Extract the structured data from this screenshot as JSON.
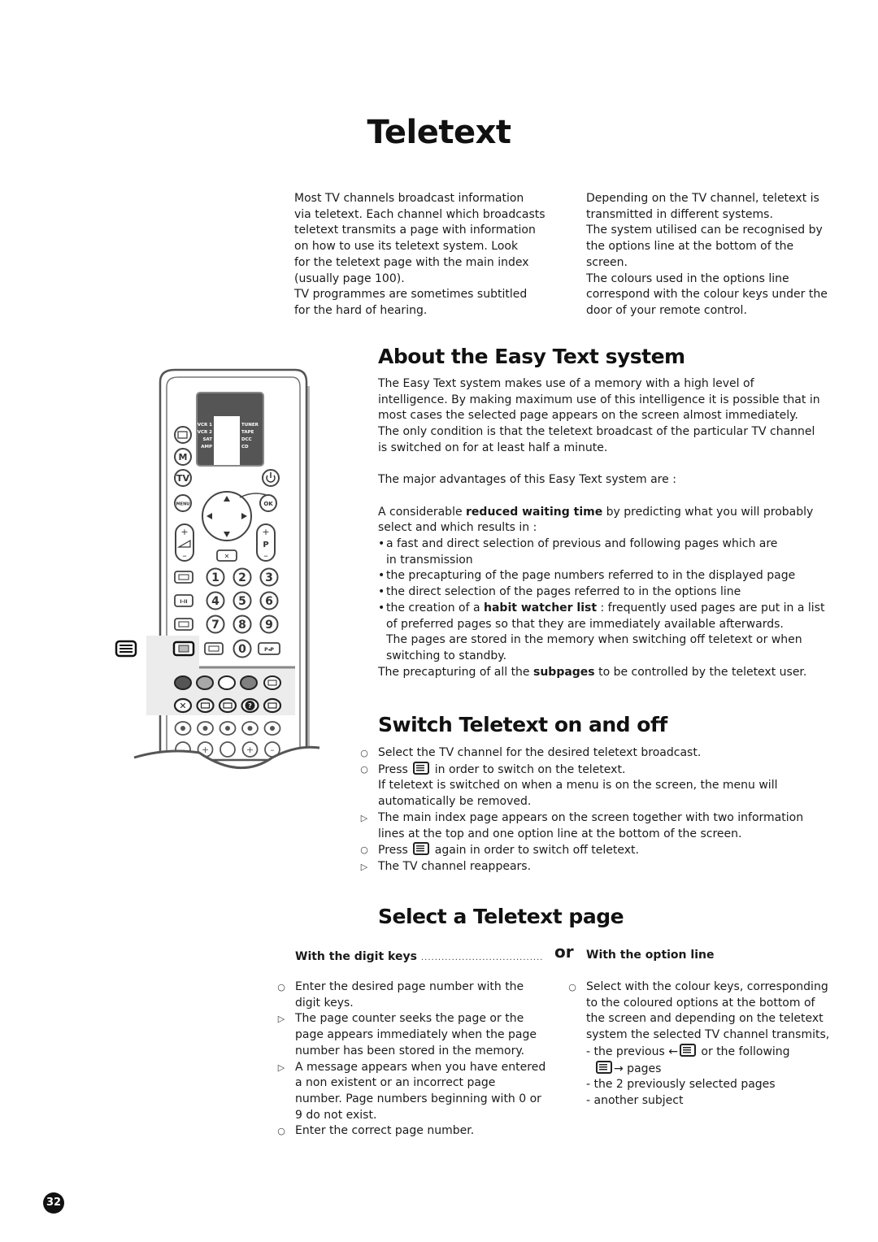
{
  "page": {
    "title": "Teletext",
    "page_number": "32"
  },
  "intro": {
    "left": [
      "Most TV channels broadcast information",
      "via teletext. Each channel which broadcasts",
      "teletext transmits a page with information",
      "on how to use its teletext system. Look",
      "for the teletext page with the main index",
      "(usually page 100).",
      "TV programmes are sometimes subtitled",
      "for the hard of hearing."
    ],
    "right": [
      "Depending on the TV channel, teletext is",
      "transmitted in different systems.",
      "The system utilised can be recognised by",
      "the options line at the bottom of the",
      "screen.",
      "The colours used in the options line",
      "correspond with the colour keys under the",
      "door of your remote control."
    ]
  },
  "easy_text": {
    "heading": "About the Easy Text system",
    "para1": [
      "The Easy Text system makes use of a memory with a high level of",
      "intelligence. By making maximum use of this intelligence it is possible that in",
      "most cases the selected page appears on the screen almost immediately.",
      "The only condition is that the teletext broadcast of the particular TV channel",
      "is switched on for at least half a minute."
    ],
    "advantages_intro": "The major advantages of this Easy Text system are :",
    "waiting_pre": "A considerable ",
    "waiting_bold": "reduced waiting time",
    "waiting_post": " by predicting what you will probably",
    "waiting_line2": "select and which results in :",
    "bullet_char": "•",
    "bullet1_line1": "a fast and direct selection of previous and following pages which are",
    "bullet1_line2": "in transmission",
    "bullet2": "the precapturing of the page numbers referred to in the displayed page",
    "bullet3": "the direct selection of the pages referred to in the options line",
    "bullet4_pre": "the creation of a ",
    "bullet4_bold": "habit watcher list",
    "bullet4_post": " : frequently used pages are put in a list",
    "bullet4_line2": "of preferred pages so that they are immediately available afterwards.",
    "bullet4_line3": "The pages are stored in the memory when switching off teletext or when",
    "bullet4_line4": "switching to standby.",
    "subpages_pre": "The precapturing of all the ",
    "subpages_bold": "subpages",
    "subpages_post": " to be controlled by the teletext user."
  },
  "switch": {
    "heading": "Switch Teletext on and off",
    "step_marker": "○",
    "result_marker": "▷",
    "s1": "Select the TV channel for the desired teletext broadcast.",
    "s2_pre": "Press ",
    "s2_post": " in order to switch on the teletext.",
    "s2_line2": "If teletext is switched on when a menu is on the screen, the menu will",
    "s2_line3": "automatically be removed.",
    "r1_line1": "The main index page appears on the screen together with two information",
    "r1_line2": "lines at the top and one option line at the bottom of the screen.",
    "s3_pre": "Press ",
    "s3_post": " again in order to switch off teletext.",
    "r2": "The TV channel reappears."
  },
  "select": {
    "heading": "Select a Teletext page",
    "digit_heading": "With the digit keys",
    "leader_dots": "....................................",
    "or": "or",
    "option_heading": "With the option line",
    "digit_steps": [
      {
        "marker": "○",
        "lines": [
          "Enter the desired page number with the",
          "digit keys."
        ]
      },
      {
        "marker": "▷",
        "lines": [
          "The page counter seeks the page or the",
          "page appears immediately when the page",
          "number has been stored in the memory."
        ]
      },
      {
        "marker": "▷",
        "lines": [
          "A message appears when you have entered",
          "a non existent or an incorrect page",
          "number. Page numbers beginning with 0 or",
          "9 do not exist."
        ]
      },
      {
        "marker": "○",
        "lines": [
          "Enter the correct page number."
        ]
      }
    ],
    "option_marker": "○",
    "option_lines": [
      "Select with the colour keys, corresponding",
      "to the coloured options at the bottom of",
      "the screen and depending on the teletext",
      "system the selected TV channel transmits,"
    ],
    "prev_pre": "- the previous ",
    "arrow_left": "←",
    "prev_post": " or the following",
    "arrow_right": "→",
    "next_post": " pages",
    "dash2": "- the 2 previously selected pages",
    "dash3": "- another subject"
  },
  "remote": {
    "screen_selected": "TV",
    "screen_left": [
      "VCR 1",
      "VCR 2",
      "SAT",
      "AMP"
    ],
    "screen_right": [
      "TUNER",
      "TAPE",
      "DCC",
      "CD"
    ],
    "menu_label": "MENU",
    "ok_label": "OK",
    "m_label": "M",
    "tv_label": "TV",
    "p_label": "P",
    "plus": "+",
    "minus": "–",
    "digits": [
      "1",
      "2",
      "3",
      "4",
      "5",
      "6",
      "7",
      "8",
      "9",
      "0"
    ],
    "dual_label": "I-II",
    "pp_label": "P◂P",
    "color_keys": [
      "#555555",
      "#a8a8a8",
      "#ffffff",
      "#808080"
    ],
    "question": "?"
  }
}
